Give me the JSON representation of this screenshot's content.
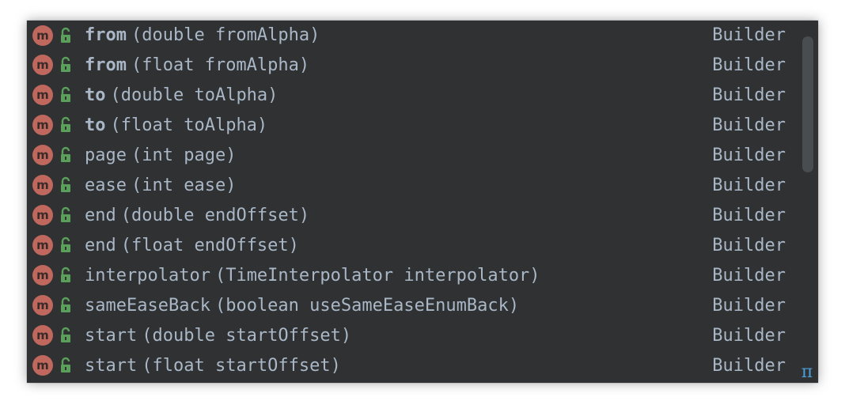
{
  "popup": {
    "items": [
      {
        "name": "from",
        "bold": true,
        "params": "(double fromAlpha)",
        "type": "Builder"
      },
      {
        "name": "from",
        "bold": true,
        "params": "(float fromAlpha)",
        "type": "Builder"
      },
      {
        "name": "to",
        "bold": true,
        "params": "(double toAlpha)",
        "type": "Builder"
      },
      {
        "name": "to",
        "bold": true,
        "params": "(float toAlpha)",
        "type": "Builder"
      },
      {
        "name": "page",
        "bold": false,
        "params": "(int page)",
        "type": "Builder"
      },
      {
        "name": "ease",
        "bold": false,
        "params": "(int ease)",
        "type": "Builder"
      },
      {
        "name": "end",
        "bold": false,
        "params": "(double endOffset)",
        "type": "Builder"
      },
      {
        "name": "end",
        "bold": false,
        "params": "(float endOffset)",
        "type": "Builder"
      },
      {
        "name": "interpolator",
        "bold": false,
        "params": "(TimeInterpolator interpolator)",
        "type": "Builder"
      },
      {
        "name": "sameEaseBack",
        "bold": false,
        "params": "(boolean useSameEaseEnumBack)",
        "type": "Builder"
      },
      {
        "name": "start",
        "bold": false,
        "params": "(double startOffset)",
        "type": "Builder"
      },
      {
        "name": "start",
        "bold": false,
        "params": "(float startOffset)",
        "type": "Builder"
      }
    ],
    "method_badge": "m",
    "method_icon": "method-icon",
    "visibility_icon": "public-unlocked-icon",
    "corner_icon": "pi-icon",
    "corner_glyph": "π"
  },
  "colors": {
    "background": "#2f3133",
    "text": "#a9b7c6",
    "method_badge": "#c0685d",
    "lock": "#5aa05a",
    "pi": "#4a9fd8",
    "scroll_thumb": "#4a4d50"
  }
}
